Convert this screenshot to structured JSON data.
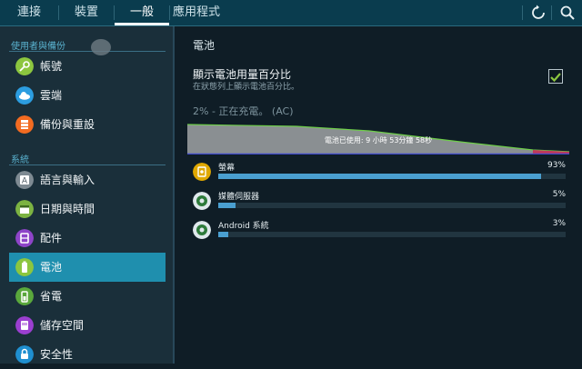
{
  "tabs": [
    {
      "label": "連接",
      "active": false
    },
    {
      "label": "裝置",
      "active": false
    },
    {
      "label": "一般",
      "active": true
    },
    {
      "label": "應用程式",
      "active": false
    }
  ],
  "top_icons": [
    "refresh-icon",
    "search-icon"
  ],
  "sidebar": {
    "sections": [
      {
        "header": "使用者與備份",
        "items": [
          {
            "label": "帳號",
            "icon": "key-icon",
            "color": "#8cc63f"
          },
          {
            "label": "雲端",
            "icon": "cloud-icon",
            "color": "#2c9de0"
          },
          {
            "label": "備份與重設",
            "icon": "backup-icon",
            "color": "#f26b21"
          }
        ]
      },
      {
        "header": "系統",
        "items": [
          {
            "label": "語言與輸入",
            "icon": "keyboard-icon",
            "color": "#7e8a92"
          },
          {
            "label": "日期與時間",
            "icon": "calendar-icon",
            "color": "#7cb342"
          },
          {
            "label": "配件",
            "icon": "accessory-icon",
            "color": "#8e44c8"
          },
          {
            "label": "電池",
            "icon": "battery-icon",
            "color": "#8cc63f",
            "selected": true
          },
          {
            "label": "省電",
            "icon": "power-saving-icon",
            "color": "#5aa83c"
          },
          {
            "label": "儲存空間",
            "icon": "storage-icon",
            "color": "#9b3fd0"
          },
          {
            "label": "安全性",
            "icon": "lock-icon",
            "color": "#1f8fd0"
          }
        ]
      }
    ]
  },
  "battery": {
    "title": "電池",
    "show_percent_label": "顯示電池用量百分比",
    "show_percent_desc": "在狀態列上顯示電池百分比。",
    "show_percent_checked": true,
    "status": "2% - 正在充電。 (AC)",
    "usage_time": "電池已使用: 9 小時 53分鐘 58秒",
    "apps": [
      {
        "name": "螢幕",
        "percent_label": "93%",
        "fraction": 0.93,
        "icon": "screen-icon"
      },
      {
        "name": "媒體伺服器",
        "percent_label": "5%",
        "fraction": 0.05,
        "icon": "android-icon"
      },
      {
        "name": "Android 系統",
        "percent_label": "3%",
        "fraction": 0.03,
        "icon": "android-icon"
      }
    ]
  },
  "colors": {
    "accent": "#1f8fae",
    "bar": "#4a9fd0",
    "topbar": "#0a3c4e"
  }
}
